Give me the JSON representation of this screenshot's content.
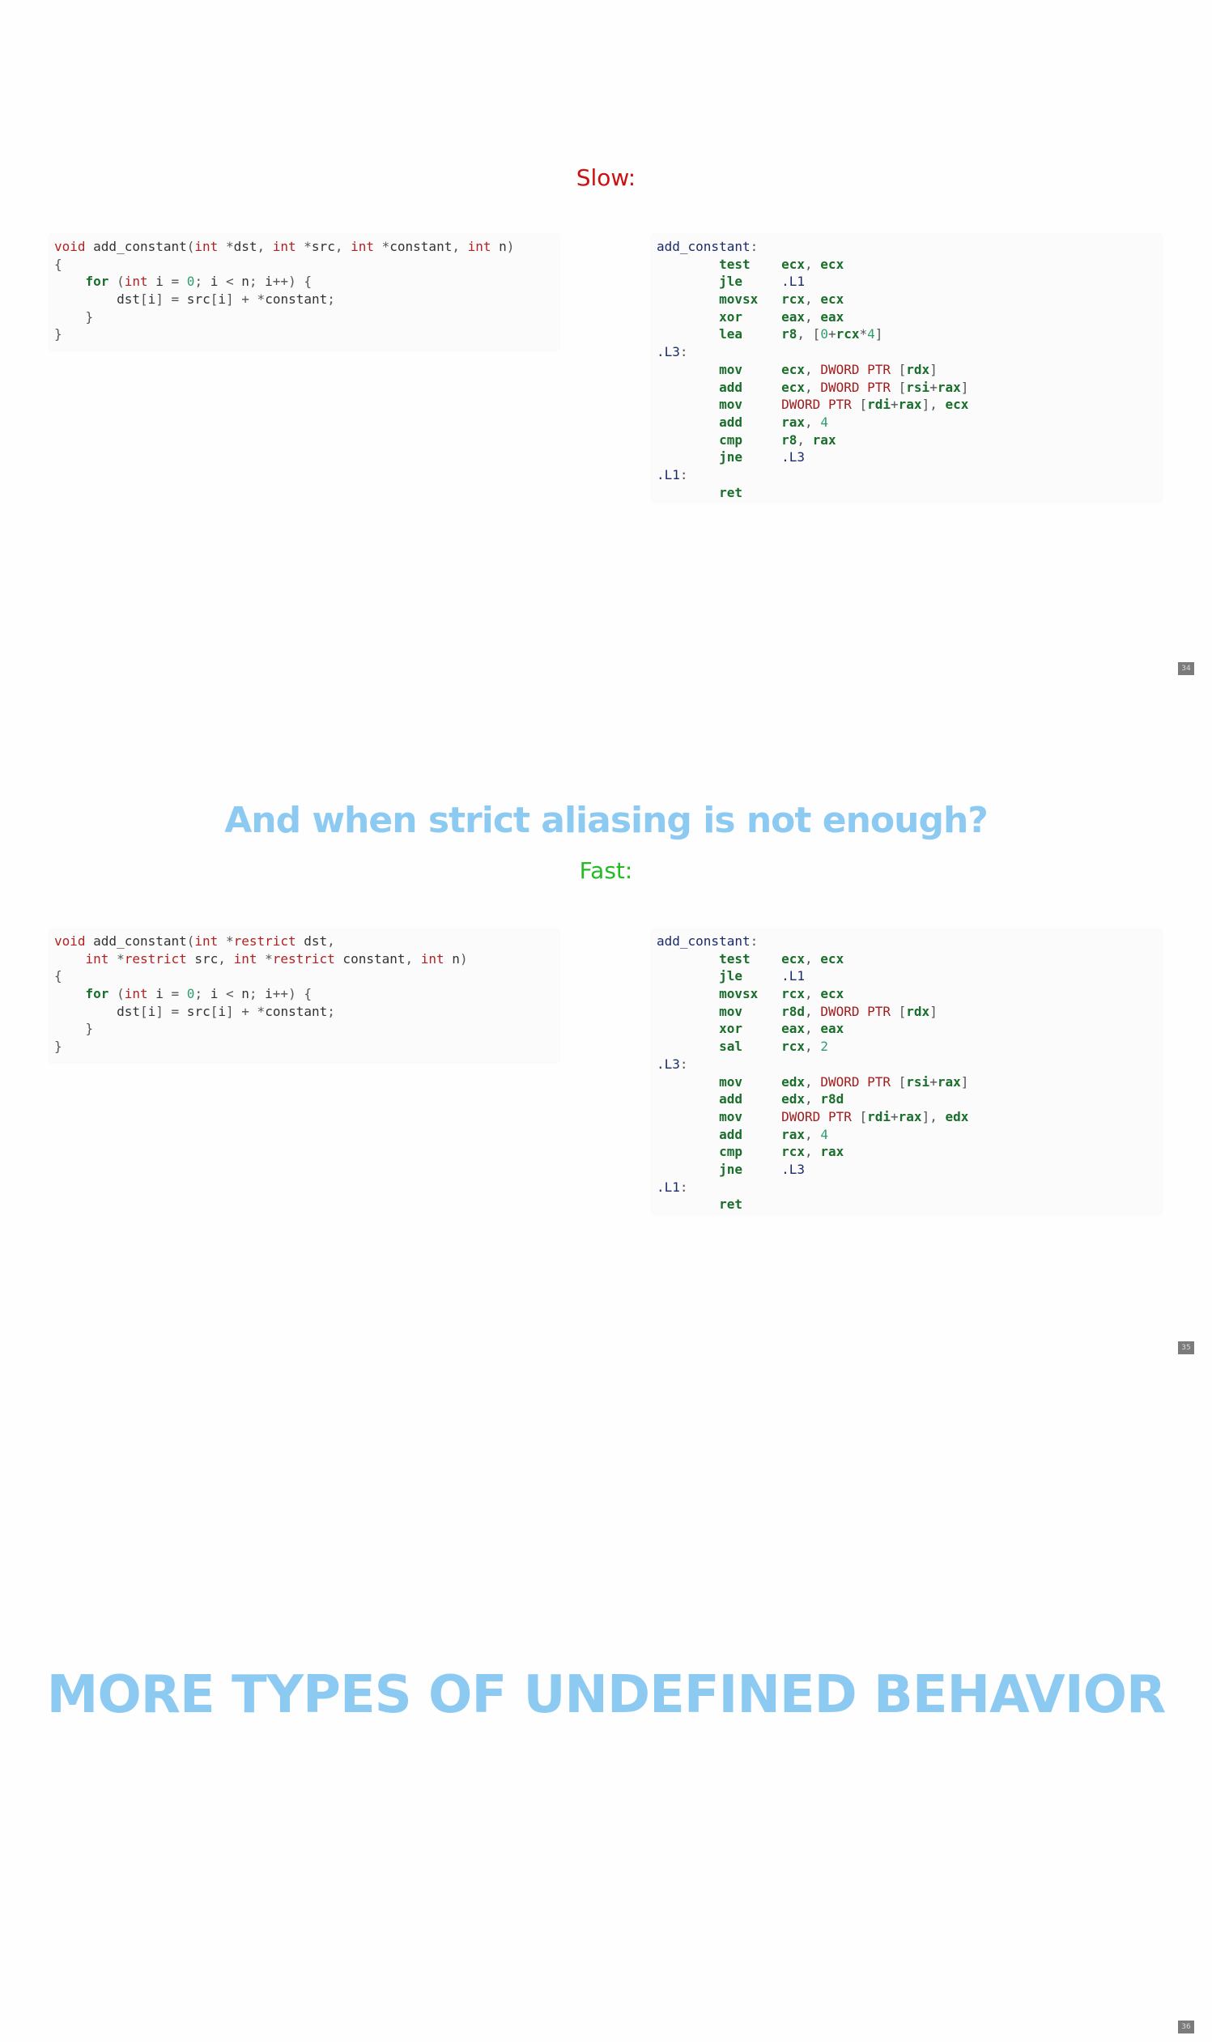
{
  "slides": [
    {
      "subtitle": "Slow:",
      "page_number": "34",
      "c_code": [
        [
          {
            "t": "void",
            "c": "kw"
          },
          {
            "t": " add_constant"
          },
          {
            "t": "(",
            "c": "pun"
          },
          {
            "t": "int",
            "c": "kw"
          },
          {
            "t": " *",
            "c": "pun"
          },
          {
            "t": "dst"
          },
          {
            "t": ", ",
            "c": "pun"
          },
          {
            "t": "int",
            "c": "kw"
          },
          {
            "t": " *",
            "c": "pun"
          },
          {
            "t": "src"
          },
          {
            "t": ", ",
            "c": "pun"
          },
          {
            "t": "int",
            "c": "kw"
          },
          {
            "t": " *",
            "c": "pun"
          },
          {
            "t": "constant"
          },
          {
            "t": ", ",
            "c": "pun"
          },
          {
            "t": "int",
            "c": "kw"
          },
          {
            "t": " n"
          },
          {
            "t": ")",
            "c": "pun"
          }
        ],
        [
          {
            "t": "{",
            "c": "pun"
          }
        ],
        [
          {
            "t": "    "
          },
          {
            "t": "for",
            "c": "kb"
          },
          {
            "t": " (",
            "c": "pun"
          },
          {
            "t": "int",
            "c": "kw"
          },
          {
            "t": " i "
          },
          {
            "t": "=",
            "c": "pun"
          },
          {
            "t": " "
          },
          {
            "t": "0",
            "c": "num"
          },
          {
            "t": ";",
            "c": "pun"
          },
          {
            "t": " i "
          },
          {
            "t": "<",
            "c": "pun"
          },
          {
            "t": " n"
          },
          {
            "t": ";",
            "c": "pun"
          },
          {
            "t": " i"
          },
          {
            "t": "++) {",
            "c": "pun"
          }
        ],
        [
          {
            "t": "        dst"
          },
          {
            "t": "[",
            "c": "pun"
          },
          {
            "t": "i"
          },
          {
            "t": "]",
            "c": "pun"
          },
          {
            "t": " "
          },
          {
            "t": "=",
            "c": "pun"
          },
          {
            "t": " src"
          },
          {
            "t": "[",
            "c": "pun"
          },
          {
            "t": "i"
          },
          {
            "t": "]",
            "c": "pun"
          },
          {
            "t": " "
          },
          {
            "t": "+",
            "c": "pun"
          },
          {
            "t": " "
          },
          {
            "t": "*",
            "c": "pun"
          },
          {
            "t": "constant"
          },
          {
            "t": ";",
            "c": "pun"
          }
        ],
        [
          {
            "t": "    "
          },
          {
            "t": "}",
            "c": "pun"
          }
        ],
        [
          {
            "t": "}",
            "c": "pun"
          }
        ]
      ],
      "asm_code": [
        [
          {
            "t": "add_constant",
            "c": "lbl"
          },
          {
            "t": ":",
            "c": "pun"
          }
        ],
        [
          {
            "t": "        "
          },
          {
            "t": "test",
            "c": "ins"
          },
          {
            "t": "    "
          },
          {
            "t": "ecx",
            "c": "reg"
          },
          {
            "t": ", ",
            "c": "pun"
          },
          {
            "t": "ecx",
            "c": "reg"
          }
        ],
        [
          {
            "t": "        "
          },
          {
            "t": "jle",
            "c": "ins"
          },
          {
            "t": "     "
          },
          {
            "t": ".L1",
            "c": "lbl"
          }
        ],
        [
          {
            "t": "        "
          },
          {
            "t": "movsx",
            "c": "ins"
          },
          {
            "t": "   "
          },
          {
            "t": "rcx",
            "c": "reg"
          },
          {
            "t": ", ",
            "c": "pun"
          },
          {
            "t": "ecx",
            "c": "reg"
          }
        ],
        [
          {
            "t": "        "
          },
          {
            "t": "xor",
            "c": "ins"
          },
          {
            "t": "     "
          },
          {
            "t": "eax",
            "c": "reg"
          },
          {
            "t": ", ",
            "c": "pun"
          },
          {
            "t": "eax",
            "c": "reg"
          }
        ],
        [
          {
            "t": "        "
          },
          {
            "t": "lea",
            "c": "ins"
          },
          {
            "t": "     "
          },
          {
            "t": "r8",
            "c": "reg"
          },
          {
            "t": ", [",
            "c": "pun"
          },
          {
            "t": "0",
            "c": "num"
          },
          {
            "t": "+",
            "c": "pun"
          },
          {
            "t": "rcx",
            "c": "reg"
          },
          {
            "t": "*",
            "c": "pun"
          },
          {
            "t": "4",
            "c": "num"
          },
          {
            "t": "]",
            "c": "pun"
          }
        ],
        [
          {
            "t": ".L3",
            "c": "lbl"
          },
          {
            "t": ":",
            "c": "pun"
          }
        ],
        [
          {
            "t": "        "
          },
          {
            "t": "mov",
            "c": "ins"
          },
          {
            "t": "     "
          },
          {
            "t": "ecx",
            "c": "reg"
          },
          {
            "t": ", ",
            "c": "pun"
          },
          {
            "t": "DWORD PTR",
            "c": "ptr"
          },
          {
            "t": " [",
            "c": "pun"
          },
          {
            "t": "rdx",
            "c": "reg"
          },
          {
            "t": "]",
            "c": "pun"
          }
        ],
        [
          {
            "t": "        "
          },
          {
            "t": "add",
            "c": "ins"
          },
          {
            "t": "     "
          },
          {
            "t": "ecx",
            "c": "reg"
          },
          {
            "t": ", ",
            "c": "pun"
          },
          {
            "t": "DWORD PTR",
            "c": "ptr"
          },
          {
            "t": " [",
            "c": "pun"
          },
          {
            "t": "rsi",
            "c": "reg"
          },
          {
            "t": "+",
            "c": "pun"
          },
          {
            "t": "rax",
            "c": "reg"
          },
          {
            "t": "]",
            "c": "pun"
          }
        ],
        [
          {
            "t": "        "
          },
          {
            "t": "mov",
            "c": "ins"
          },
          {
            "t": "     "
          },
          {
            "t": "DWORD PTR",
            "c": "ptr"
          },
          {
            "t": " [",
            "c": "pun"
          },
          {
            "t": "rdi",
            "c": "reg"
          },
          {
            "t": "+",
            "c": "pun"
          },
          {
            "t": "rax",
            "c": "reg"
          },
          {
            "t": "], ",
            "c": "pun"
          },
          {
            "t": "ecx",
            "c": "reg"
          }
        ],
        [
          {
            "t": "        "
          },
          {
            "t": "add",
            "c": "ins"
          },
          {
            "t": "     "
          },
          {
            "t": "rax",
            "c": "reg"
          },
          {
            "t": ", ",
            "c": "pun"
          },
          {
            "t": "4",
            "c": "num"
          }
        ],
        [
          {
            "t": "        "
          },
          {
            "t": "cmp",
            "c": "ins"
          },
          {
            "t": "     "
          },
          {
            "t": "r8",
            "c": "reg"
          },
          {
            "t": ", ",
            "c": "pun"
          },
          {
            "t": "rax",
            "c": "reg"
          }
        ],
        [
          {
            "t": "        "
          },
          {
            "t": "jne",
            "c": "ins"
          },
          {
            "t": "     "
          },
          {
            "t": ".L3",
            "c": "lbl"
          }
        ],
        [
          {
            "t": ".L1",
            "c": "lbl"
          },
          {
            "t": ":",
            "c": "pun"
          }
        ],
        [
          {
            "t": "        "
          },
          {
            "t": "ret",
            "c": "ins"
          }
        ]
      ]
    },
    {
      "title": "And when strict aliasing is not enough?",
      "subtitle": "Fast:",
      "page_number": "35",
      "c_code": [
        [
          {
            "t": "void",
            "c": "kw"
          },
          {
            "t": " add_constant"
          },
          {
            "t": "(",
            "c": "pun"
          },
          {
            "t": "int",
            "c": "kw"
          },
          {
            "t": " *",
            "c": "pun"
          },
          {
            "t": "restrict",
            "c": "kw"
          },
          {
            "t": " dst"
          },
          {
            "t": ",",
            "c": "pun"
          }
        ],
        [
          {
            "t": "    "
          },
          {
            "t": "int",
            "c": "kw"
          },
          {
            "t": " *",
            "c": "pun"
          },
          {
            "t": "restrict",
            "c": "kw"
          },
          {
            "t": " src"
          },
          {
            "t": ", ",
            "c": "pun"
          },
          {
            "t": "int",
            "c": "kw"
          },
          {
            "t": " *",
            "c": "pun"
          },
          {
            "t": "restrict",
            "c": "kw"
          },
          {
            "t": " constant"
          },
          {
            "t": ", ",
            "c": "pun"
          },
          {
            "t": "int",
            "c": "kw"
          },
          {
            "t": " n"
          },
          {
            "t": ")",
            "c": "pun"
          }
        ],
        [
          {
            "t": "{",
            "c": "pun"
          }
        ],
        [
          {
            "t": "    "
          },
          {
            "t": "for",
            "c": "kb"
          },
          {
            "t": " (",
            "c": "pun"
          },
          {
            "t": "int",
            "c": "kw"
          },
          {
            "t": " i "
          },
          {
            "t": "=",
            "c": "pun"
          },
          {
            "t": " "
          },
          {
            "t": "0",
            "c": "num"
          },
          {
            "t": ";",
            "c": "pun"
          },
          {
            "t": " i "
          },
          {
            "t": "<",
            "c": "pun"
          },
          {
            "t": " n"
          },
          {
            "t": ";",
            "c": "pun"
          },
          {
            "t": " i"
          },
          {
            "t": "++) {",
            "c": "pun"
          }
        ],
        [
          {
            "t": "        dst"
          },
          {
            "t": "[",
            "c": "pun"
          },
          {
            "t": "i"
          },
          {
            "t": "]",
            "c": "pun"
          },
          {
            "t": " "
          },
          {
            "t": "=",
            "c": "pun"
          },
          {
            "t": " src"
          },
          {
            "t": "[",
            "c": "pun"
          },
          {
            "t": "i"
          },
          {
            "t": "]",
            "c": "pun"
          },
          {
            "t": " "
          },
          {
            "t": "+",
            "c": "pun"
          },
          {
            "t": " "
          },
          {
            "t": "*",
            "c": "pun"
          },
          {
            "t": "constant"
          },
          {
            "t": ";",
            "c": "pun"
          }
        ],
        [
          {
            "t": "    "
          },
          {
            "t": "}",
            "c": "pun"
          }
        ],
        [
          {
            "t": "}",
            "c": "pun"
          }
        ]
      ],
      "asm_code": [
        [
          {
            "t": "add_constant",
            "c": "lbl"
          },
          {
            "t": ":",
            "c": "pun"
          }
        ],
        [
          {
            "t": "        "
          },
          {
            "t": "test",
            "c": "ins"
          },
          {
            "t": "    "
          },
          {
            "t": "ecx",
            "c": "reg"
          },
          {
            "t": ", ",
            "c": "pun"
          },
          {
            "t": "ecx",
            "c": "reg"
          }
        ],
        [
          {
            "t": "        "
          },
          {
            "t": "jle",
            "c": "ins"
          },
          {
            "t": "     "
          },
          {
            "t": ".L1",
            "c": "lbl"
          }
        ],
        [
          {
            "t": "        "
          },
          {
            "t": "movsx",
            "c": "ins"
          },
          {
            "t": "   "
          },
          {
            "t": "rcx",
            "c": "reg"
          },
          {
            "t": ", ",
            "c": "pun"
          },
          {
            "t": "ecx",
            "c": "reg"
          }
        ],
        [
          {
            "t": "        "
          },
          {
            "t": "mov",
            "c": "ins"
          },
          {
            "t": "     "
          },
          {
            "t": "r8d",
            "c": "reg"
          },
          {
            "t": ", ",
            "c": "pun"
          },
          {
            "t": "DWORD PTR",
            "c": "ptr"
          },
          {
            "t": " [",
            "c": "pun"
          },
          {
            "t": "rdx",
            "c": "reg"
          },
          {
            "t": "]",
            "c": "pun"
          }
        ],
        [
          {
            "t": "        "
          },
          {
            "t": "xor",
            "c": "ins"
          },
          {
            "t": "     "
          },
          {
            "t": "eax",
            "c": "reg"
          },
          {
            "t": ", ",
            "c": "pun"
          },
          {
            "t": "eax",
            "c": "reg"
          }
        ],
        [
          {
            "t": "        "
          },
          {
            "t": "sal",
            "c": "ins"
          },
          {
            "t": "     "
          },
          {
            "t": "rcx",
            "c": "reg"
          },
          {
            "t": ", ",
            "c": "pun"
          },
          {
            "t": "2",
            "c": "num"
          }
        ],
        [
          {
            "t": ".L3",
            "c": "lbl"
          },
          {
            "t": ":",
            "c": "pun"
          }
        ],
        [
          {
            "t": "        "
          },
          {
            "t": "mov",
            "c": "ins"
          },
          {
            "t": "     "
          },
          {
            "t": "edx",
            "c": "reg"
          },
          {
            "t": ", ",
            "c": "pun"
          },
          {
            "t": "DWORD PTR",
            "c": "ptr"
          },
          {
            "t": " [",
            "c": "pun"
          },
          {
            "t": "rsi",
            "c": "reg"
          },
          {
            "t": "+",
            "c": "pun"
          },
          {
            "t": "rax",
            "c": "reg"
          },
          {
            "t": "]",
            "c": "pun"
          }
        ],
        [
          {
            "t": "        "
          },
          {
            "t": "add",
            "c": "ins"
          },
          {
            "t": "     "
          },
          {
            "t": "edx",
            "c": "reg"
          },
          {
            "t": ", ",
            "c": "pun"
          },
          {
            "t": "r8d",
            "c": "reg"
          }
        ],
        [
          {
            "t": "        "
          },
          {
            "t": "mov",
            "c": "ins"
          },
          {
            "t": "     "
          },
          {
            "t": "DWORD PTR",
            "c": "ptr"
          },
          {
            "t": " [",
            "c": "pun"
          },
          {
            "t": "rdi",
            "c": "reg"
          },
          {
            "t": "+",
            "c": "pun"
          },
          {
            "t": "rax",
            "c": "reg"
          },
          {
            "t": "], ",
            "c": "pun"
          },
          {
            "t": "edx",
            "c": "reg"
          }
        ],
        [
          {
            "t": "        "
          },
          {
            "t": "add",
            "c": "ins"
          },
          {
            "t": "     "
          },
          {
            "t": "rax",
            "c": "reg"
          },
          {
            "t": ", ",
            "c": "pun"
          },
          {
            "t": "4",
            "c": "num"
          }
        ],
        [
          {
            "t": "        "
          },
          {
            "t": "cmp",
            "c": "ins"
          },
          {
            "t": "     "
          },
          {
            "t": "rcx",
            "c": "reg"
          },
          {
            "t": ", ",
            "c": "pun"
          },
          {
            "t": "rax",
            "c": "reg"
          }
        ],
        [
          {
            "t": "        "
          },
          {
            "t": "jne",
            "c": "ins"
          },
          {
            "t": "     "
          },
          {
            "t": ".L3",
            "c": "lbl"
          }
        ],
        [
          {
            "t": ".L1",
            "c": "lbl"
          },
          {
            "t": ":",
            "c": "pun"
          }
        ],
        [
          {
            "t": "        "
          },
          {
            "t": "ret",
            "c": "ins"
          }
        ]
      ]
    },
    {
      "title": "MORE TYPES OF UNDEFINED BEHAVIOR",
      "page_number": "36"
    }
  ]
}
